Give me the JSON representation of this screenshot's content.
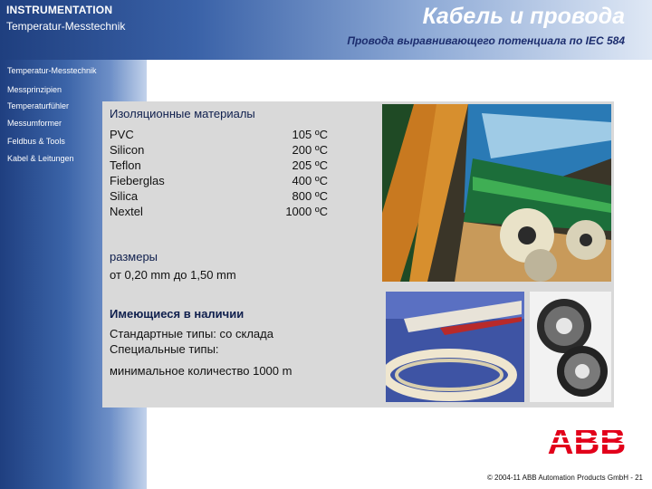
{
  "header": {
    "brand_line1": "INSTRUMENTATION",
    "brand_line2": "Temperatur-Messtechnik",
    "title": "Кабель и провода",
    "subtitle": "Провода выравнивающего потенциала по IEC 584"
  },
  "nav": {
    "items": [
      {
        "label": "Temperatur-Messtechnik"
      },
      {
        "label": "Messprinzipien"
      },
      {
        "label": "Temperaturfühler"
      },
      {
        "label": "Messumformer"
      },
      {
        "label": "Feldbus & Tools"
      },
      {
        "label": "Kabel & Leitungen"
      }
    ]
  },
  "insulation": {
    "title": "Изоляционные материалы",
    "rows": [
      {
        "material": "PVC",
        "temp": "105 ºC"
      },
      {
        "material": "Silicon",
        "temp": "200 ºC"
      },
      {
        "material": "Teflon",
        "temp": "205 ºC"
      },
      {
        "material": "Fieberglas",
        "temp": "400 ºC"
      },
      {
        "material": "Silica",
        "temp": "800 ºC"
      },
      {
        "material": "Nextel",
        "temp": "1000 ºC"
      }
    ]
  },
  "sizes": {
    "title": "размеры",
    "range": "от 0,20 mm  до 1,50 mm"
  },
  "availability": {
    "title": "Имеющиеся в наличии",
    "line1": "Стандартные типы: со склада",
    "line2": "Специальные типы:",
    "min_qty": "минимальное количество 1000 m"
  },
  "logo": {
    "text": "ABB",
    "color": "#e2001a"
  },
  "footer": {
    "copyright": "© 2004-11 ABB Automation Products GmbH - 21"
  },
  "colors": {
    "header_dark": "#1f3f7f",
    "content_bg": "#d9d9d9",
    "title_dark": "#1c2d6e"
  },
  "photos": [
    {
      "icon": "cable-spools-photo"
    },
    {
      "icon": "wire-coil-photo"
    },
    {
      "icon": "wire-reels-photo"
    }
  ]
}
